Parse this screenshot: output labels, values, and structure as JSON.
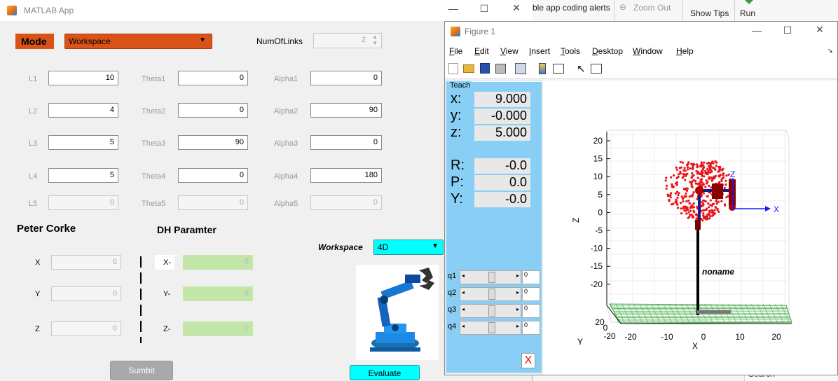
{
  "background": {
    "ribbon_items": [
      "ble app coding alerts",
      "Zoom Out",
      "Show Tips",
      "Run"
    ],
    "search_label": "Search"
  },
  "app": {
    "title": "MATLAB App",
    "mode_label": "Mode",
    "mode_value": "Workspace",
    "numoflinks_label": "NumOfLinks",
    "numoflinks_value": "2",
    "rows": [
      {
        "l": "L1",
        "lv": "10",
        "t": "Theta1",
        "tv": "0",
        "a": "Alpha1",
        "av": "0",
        "disabled": false
      },
      {
        "l": "L2",
        "lv": "4",
        "t": "Theta2",
        "tv": "0",
        "a": "Alpha2",
        "av": "90",
        "disabled": false
      },
      {
        "l": "L3",
        "lv": "5",
        "t": "Theta3",
        "tv": "90",
        "a": "Alpha3",
        "av": "0",
        "disabled": false
      },
      {
        "l": "L4",
        "lv": "5",
        "t": "Theta4",
        "tv": "0",
        "a": "Alpha4",
        "av": "180",
        "disabled": false
      },
      {
        "l": "L5",
        "lv": "0",
        "t": "Theta5",
        "tv": "0",
        "a": "Alpha5",
        "av": "0",
        "disabled": true
      }
    ],
    "peter_corke": "Peter Corke",
    "dh_param": "DH Paramter",
    "pc_fields": [
      {
        "label": "X",
        "value": "0"
      },
      {
        "label": "Y",
        "value": "0"
      },
      {
        "label": "Z",
        "value": "0"
      }
    ],
    "dh_fields": [
      {
        "label": "X-",
        "value": "0"
      },
      {
        "label": "Y-",
        "value": "0"
      },
      {
        "label": "Z-",
        "value": "0"
      }
    ],
    "workspace_label": "Workspace",
    "workspace_value": "4D",
    "evaluate": "Evaluate",
    "submit": "Sumbit"
  },
  "figure": {
    "title": "Figure 1",
    "menu": [
      "File",
      "Edit",
      "View",
      "Insert",
      "Tools",
      "Desktop",
      "Window",
      "Help"
    ],
    "teach": {
      "title": "Teach",
      "pos": [
        {
          "k": "x:",
          "v": "9.000"
        },
        {
          "k": "y:",
          "v": "-0.000"
        },
        {
          "k": "z:",
          "v": "5.000"
        }
      ],
      "rpy": [
        {
          "k": "R:",
          "v": "-0.0"
        },
        {
          "k": "P:",
          "v": "0.0"
        },
        {
          "k": "Y:",
          "v": "-0.0"
        }
      ],
      "joints": [
        {
          "k": "q1",
          "v": "0"
        },
        {
          "k": "q2",
          "v": "0"
        },
        {
          "k": "q3",
          "v": "0"
        },
        {
          "k": "q4",
          "v": "0"
        }
      ],
      "close": "X"
    },
    "plot": {
      "zlabel": "Z",
      "xlabel": "X",
      "ylabel": "Y",
      "zticks": [
        "20",
        "15",
        "10",
        "5",
        "0",
        "-5",
        "-10",
        "-15",
        "-20"
      ],
      "xticks": [
        "-20",
        "-10",
        "0",
        "10",
        "20"
      ],
      "yticks": [
        "20",
        "0",
        "-20"
      ],
      "robot_name": "noname",
      "frame_x": "X",
      "frame_z": "Z",
      "point_color": "#e8141a",
      "ground_color": "#4caf50",
      "frame_color": "#1a1aff"
    }
  }
}
